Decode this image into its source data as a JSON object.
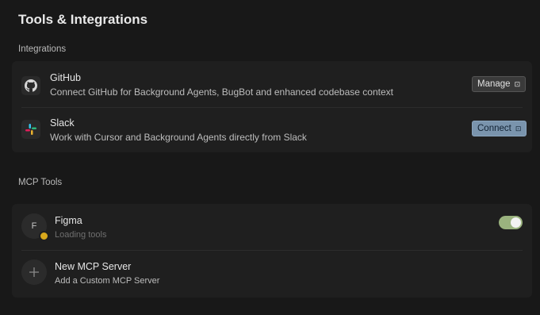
{
  "page": {
    "title": "Tools & Integrations"
  },
  "integrations": {
    "section_label": "Integrations",
    "items": [
      {
        "name": "GitHub",
        "description": "Connect GitHub for Background Agents, BugBot and enhanced codebase context",
        "action_label": "Manage",
        "icon": "github-icon"
      },
      {
        "name": "Slack",
        "description": "Work with Cursor and Background Agents directly from Slack",
        "action_label": "Connect",
        "icon": "slack-icon"
      }
    ]
  },
  "mcp": {
    "section_label": "MCP Tools",
    "servers": [
      {
        "name": "Figma",
        "initial": "F",
        "status": "Loading tools",
        "enabled": true,
        "status_color": "#d8a81c"
      }
    ],
    "add": {
      "label": "New MCP Server",
      "description": "Add a Custom MCP Server",
      "icon": "plus-icon"
    }
  },
  "colors": {
    "background": "#181818",
    "card": "#1f1f1f",
    "toggle_on": "#9ab27e",
    "connect_button": "#7a94ad"
  }
}
